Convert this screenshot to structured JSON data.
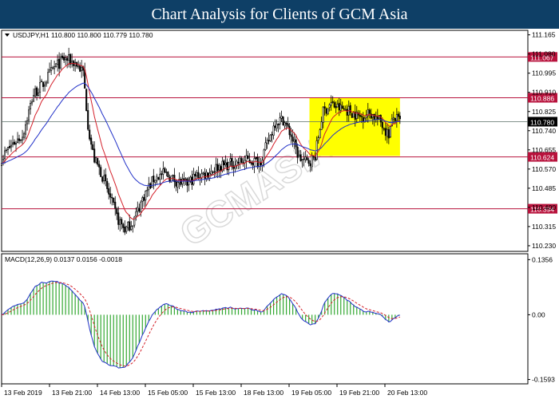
{
  "banner": {
    "title": "Chart Analysis for Clients of GCM Asia"
  },
  "chart_data": [
    {
      "type": "candlestick",
      "title": "USDJPY,H1  110.800 110.800 110.779 110.780",
      "ylim": [
        110.205,
        111.185
      ],
      "yticks": [
        111.165,
        111.08,
        110.995,
        110.91,
        110.825,
        110.74,
        110.655,
        110.57,
        110.485,
        110.4,
        110.315,
        110.23
      ],
      "xticks": [
        "13 Feb 2019",
        "13 Feb 21:00",
        "14 Feb 13:00",
        "15 Feb 05:00",
        "15 Feb 13:00",
        "18 Feb 13:00",
        "19 Feb 05:00",
        "19 Feb 21:00",
        "20 Feb 13:00"
      ],
      "current_price": {
        "value": 110.78,
        "label": "110.780"
      },
      "levels": [
        {
          "value": 111.067,
          "label": "111.067"
        },
        {
          "value": 110.886,
          "label": "110.886"
        },
        {
          "value": 110.624,
          "label": "110.624"
        },
        {
          "value": 110.394,
          "label": "110.394"
        }
      ],
      "highlight_box": {
        "x_from": 0.585,
        "x_to": 0.757,
        "y_from": 110.628,
        "y_to": 110.886,
        "color": "#ffff00"
      },
      "close_anchors": [
        [
          0.0,
          110.62
        ],
        [
          0.02,
          110.68
        ],
        [
          0.04,
          110.72
        ],
        [
          0.06,
          110.9
        ],
        [
          0.08,
          110.95
        ],
        [
          0.1,
          111.02
        ],
        [
          0.12,
          111.06
        ],
        [
          0.14,
          111.04
        ],
        [
          0.155,
          111.0
        ],
        [
          0.165,
          110.75
        ],
        [
          0.175,
          110.62
        ],
        [
          0.19,
          110.55
        ],
        [
          0.205,
          110.45
        ],
        [
          0.22,
          110.35
        ],
        [
          0.235,
          110.3
        ],
        [
          0.25,
          110.34
        ],
        [
          0.27,
          110.45
        ],
        [
          0.29,
          110.53
        ],
        [
          0.31,
          110.55
        ],
        [
          0.33,
          110.52
        ],
        [
          0.35,
          110.5
        ],
        [
          0.37,
          110.54
        ],
        [
          0.39,
          110.55
        ],
        [
          0.41,
          110.58
        ],
        [
          0.43,
          110.59
        ],
        [
          0.45,
          110.6
        ],
        [
          0.47,
          110.61
        ],
        [
          0.49,
          110.6
        ],
        [
          0.505,
          110.68
        ],
        [
          0.52,
          110.78
        ],
        [
          0.535,
          110.79
        ],
        [
          0.55,
          110.72
        ],
        [
          0.565,
          110.62
        ],
        [
          0.58,
          110.6
        ],
        [
          0.595,
          110.62
        ],
        [
          0.61,
          110.82
        ],
        [
          0.625,
          110.86
        ],
        [
          0.64,
          110.84
        ],
        [
          0.66,
          110.83
        ],
        [
          0.68,
          110.8
        ],
        [
          0.7,
          110.82
        ],
        [
          0.72,
          110.78
        ],
        [
          0.735,
          110.72
        ],
        [
          0.745,
          110.8
        ],
        [
          0.757,
          110.78
        ]
      ],
      "ma_fast_color": "#d4202a",
      "ma_slow_color": "#2030c8",
      "level_color": "#b8123c",
      "watermark": "GCMASIA"
    },
    {
      "type": "macd",
      "title": "MACD(12,26,9) 0.0137 0.0156 -0.0018",
      "ylim": [
        -0.17,
        0.15
      ],
      "yticks": [
        {
          "value": 0.1356,
          "label": "0.1356"
        },
        {
          "value": 0.0,
          "label": "0.00"
        },
        {
          "value": -0.1593,
          "label": "-0.1593"
        }
      ],
      "macd_color": "#2030c8",
      "signal_color": "#d4202a",
      "hist_color": "#33a832"
    }
  ]
}
